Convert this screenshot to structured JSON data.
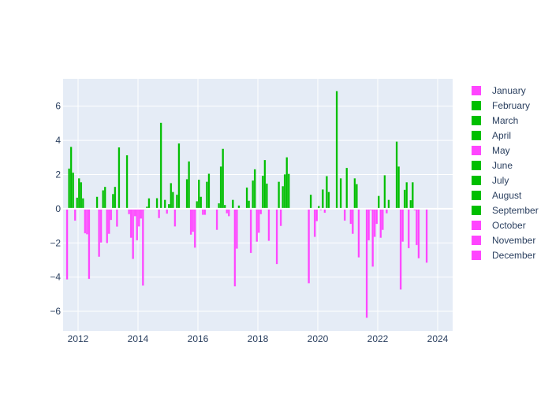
{
  "chart_data": {
    "type": "bar",
    "barmode": "group",
    "title": "",
    "xlabel": "",
    "ylabel": "",
    "x": [
      2012,
      2013,
      2014,
      2015,
      2016,
      2017,
      2018,
      2019,
      2020,
      2021,
      2022,
      2023,
      2024
    ],
    "xlim": [
      2011.5,
      2024.5
    ],
    "ylim": [
      -7.15,
      7.6
    ],
    "x_ticks": [
      2012,
      2014,
      2016,
      2018,
      2020,
      2022,
      2024
    ],
    "x_tick_labels": [
      "2012",
      "2014",
      "2016",
      "2018",
      "2020",
      "2022",
      "2024"
    ],
    "y_ticks": [
      -6,
      -4,
      -2,
      0,
      2,
      4,
      6
    ],
    "y_tick_labels": [
      "−6",
      "−4",
      "−2",
      "0",
      "2",
      "4",
      "6"
    ],
    "grid": true,
    "legend_position": "right",
    "positive_color": "#00bf00",
    "negative_color": "#ff45ff",
    "plot_background": "#e5ecf6",
    "series": [
      {
        "name": "January",
        "legend_color": "#ff45ff",
        "values": [
          -4.13,
          0.69,
          3.12,
          0.61,
          1.72,
          -1.23,
          1.23,
          -3.23,
          null,
          6.87,
          -6.37,
          3.92,
          -3.15
        ]
      },
      {
        "name": "February",
        "legend_color": "#00bf00",
        "values": [
          2.34,
          -2.8,
          -0.31,
          -0.54,
          2.76,
          0.31,
          0.46,
          1.57,
          -4.35,
          null,
          -1.84,
          2.46,
          null
        ]
      },
      {
        "name": "March",
        "legend_color": "#00bf00",
        "values": [
          3.61,
          -1.97,
          -1.69,
          5.02,
          -1.51,
          2.46,
          -2.58,
          -1.0,
          0.81,
          1.77,
          -0.08,
          -4.72,
          null
        ]
      },
      {
        "name": "April",
        "legend_color": "#00bf00",
        "values": [
          2.1,
          1.07,
          -2.93,
          null,
          -1.34,
          3.5,
          1.64,
          1.31,
          null,
          null,
          -3.38,
          -1.92,
          null
        ]
      },
      {
        "name": "May",
        "legend_color": "#ff45ff",
        "values": [
          -0.69,
          1.27,
          -0.43,
          0.51,
          -2.27,
          0.21,
          2.3,
          2.0,
          -1.64,
          -0.69,
          -1.64,
          1.1,
          null
        ]
      },
      {
        "name": "June",
        "legend_color": "#00bf00",
        "values": [
          0.64,
          -2.0,
          -1.84,
          -0.28,
          0.43,
          -0.26,
          -1.92,
          3.0,
          -0.72,
          2.38,
          -0.88,
          1.54,
          null
        ]
      },
      {
        "name": "July",
        "legend_color": "#00bf00",
        "values": [
          1.77,
          -1.46,
          -1.03,
          0.26,
          1.69,
          -0.43,
          -1.4,
          2.03,
          0.15,
          null,
          0.74,
          -2.3,
          null
        ]
      },
      {
        "name": "August",
        "legend_color": "#00bf00",
        "values": [
          1.54,
          -0.65,
          -0.57,
          1.49,
          0.69,
          null,
          -0.31,
          null,
          -0.08,
          -0.88,
          -1.69,
          0.49,
          null
        ]
      },
      {
        "name": "September",
        "legend_color": "#00bf00",
        "values": [
          0.6,
          0.85,
          -4.49,
          0.97,
          -0.35,
          0.51,
          1.92,
          null,
          1.12,
          -1.46,
          -1.23,
          1.54,
          null
        ]
      },
      {
        "name": "October",
        "legend_color": "#ff45ff",
        "values": [
          -1.43,
          1.27,
          -0.05,
          -1.03,
          -0.35,
          -4.53,
          2.84,
          null,
          -0.23,
          1.77,
          1.95,
          -0.08,
          null
        ]
      },
      {
        "name": "November",
        "legend_color": "#ff45ff",
        "values": [
          -1.49,
          -1.04,
          0.11,
          0.81,
          1.57,
          -2.33,
          1.46,
          null,
          1.9,
          1.43,
          -0.26,
          -2.12,
          null
        ]
      },
      {
        "name": "December",
        "legend_color": "#ff45ff",
        "values": [
          -4.1,
          3.58,
          0.6,
          3.81,
          2.04,
          0.18,
          -1.87,
          null,
          0.97,
          -2.84,
          0.51,
          -2.89,
          null
        ]
      }
    ]
  }
}
